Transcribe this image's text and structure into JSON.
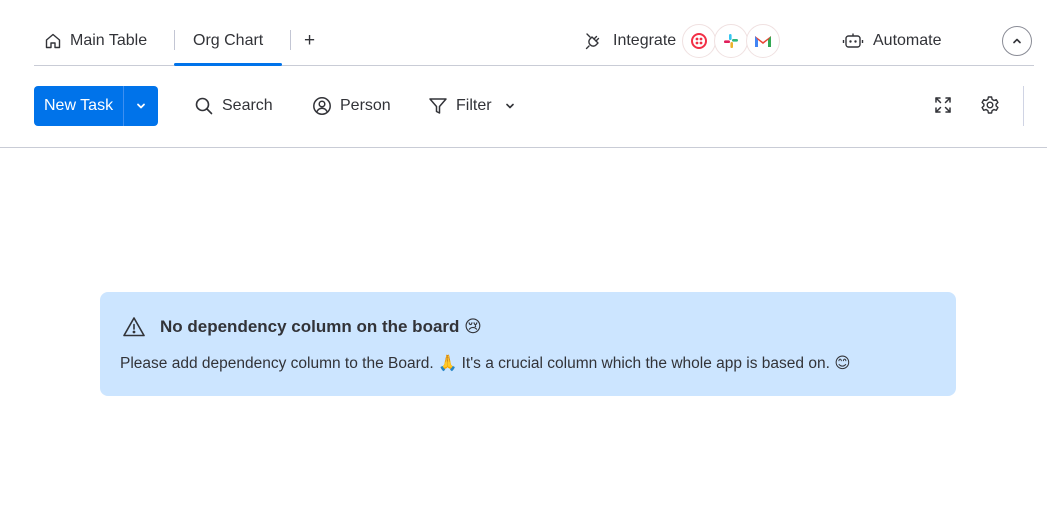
{
  "tabs": [
    {
      "label": "Main Table",
      "icon": "home-icon"
    },
    {
      "label": "Org Chart",
      "icon": "",
      "active": true
    }
  ],
  "add_tab_label": "+",
  "integrate": {
    "label": "Integrate",
    "apps": [
      "twilio-icon",
      "slack-icon",
      "gmail-icon"
    ]
  },
  "automate": {
    "label": "Automate"
  },
  "toolbar": {
    "new_task_label": "New Task",
    "search_label": "Search",
    "person_label": "Person",
    "filter_label": "Filter"
  },
  "banner": {
    "title": "No dependency column on the board",
    "title_emoji": "😢",
    "text_part1": "Please add dependency column to the Board.",
    "pray_emoji": "🙏",
    "text_part2": "It's a crucial column which the whole app is based on.",
    "smile_emoji": "😊"
  },
  "colors": {
    "primary": "#0073ea",
    "banner_bg": "#cce5ff",
    "text": "#323338",
    "divider": "#c9ccd6"
  }
}
